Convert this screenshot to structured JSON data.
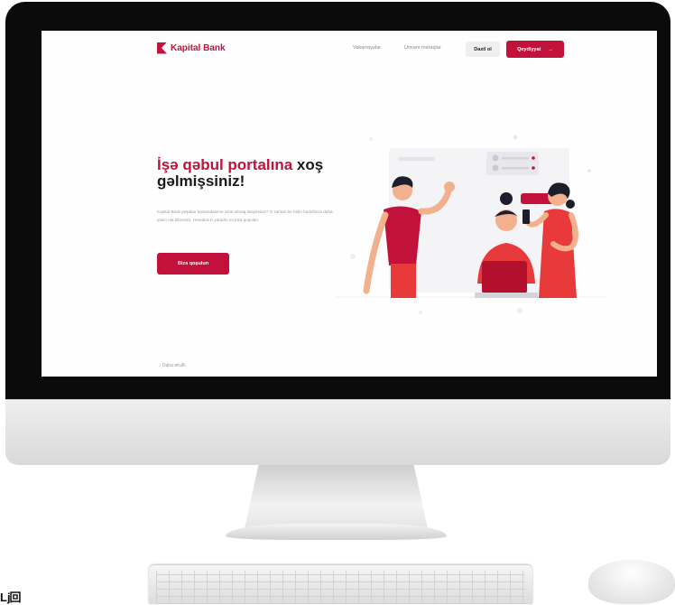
{
  "header": {
    "brand": "Kapital Bank",
    "nav": [
      "Vakansiyalar",
      "Ünvanı maraqlar"
    ],
    "login_label": "Daxil ol",
    "register_label": "Qeydiyyat",
    "register_arrow": "→"
  },
  "hero": {
    "title_accent": "İşə qəbul portalına",
    "title_rest": " xoş gəlmişsiniz!",
    "description": "Kapital Bank peşəkar komandasının üzvü olmaq istəyirsiniz? O zaman bir-birilə hədəfinizə daha yaxın ola bilərsiniz. Hesabınızı yaradın və bizə qoşulun.",
    "cta_label": "Bizə qoşulun",
    "more_label": "Daha ətraflı",
    "more_icon": "↓"
  },
  "footer": {
    "qr_text": "ǈ回"
  },
  "colors": {
    "brand": "#c2113b",
    "bezel": "#0b0b0c"
  }
}
